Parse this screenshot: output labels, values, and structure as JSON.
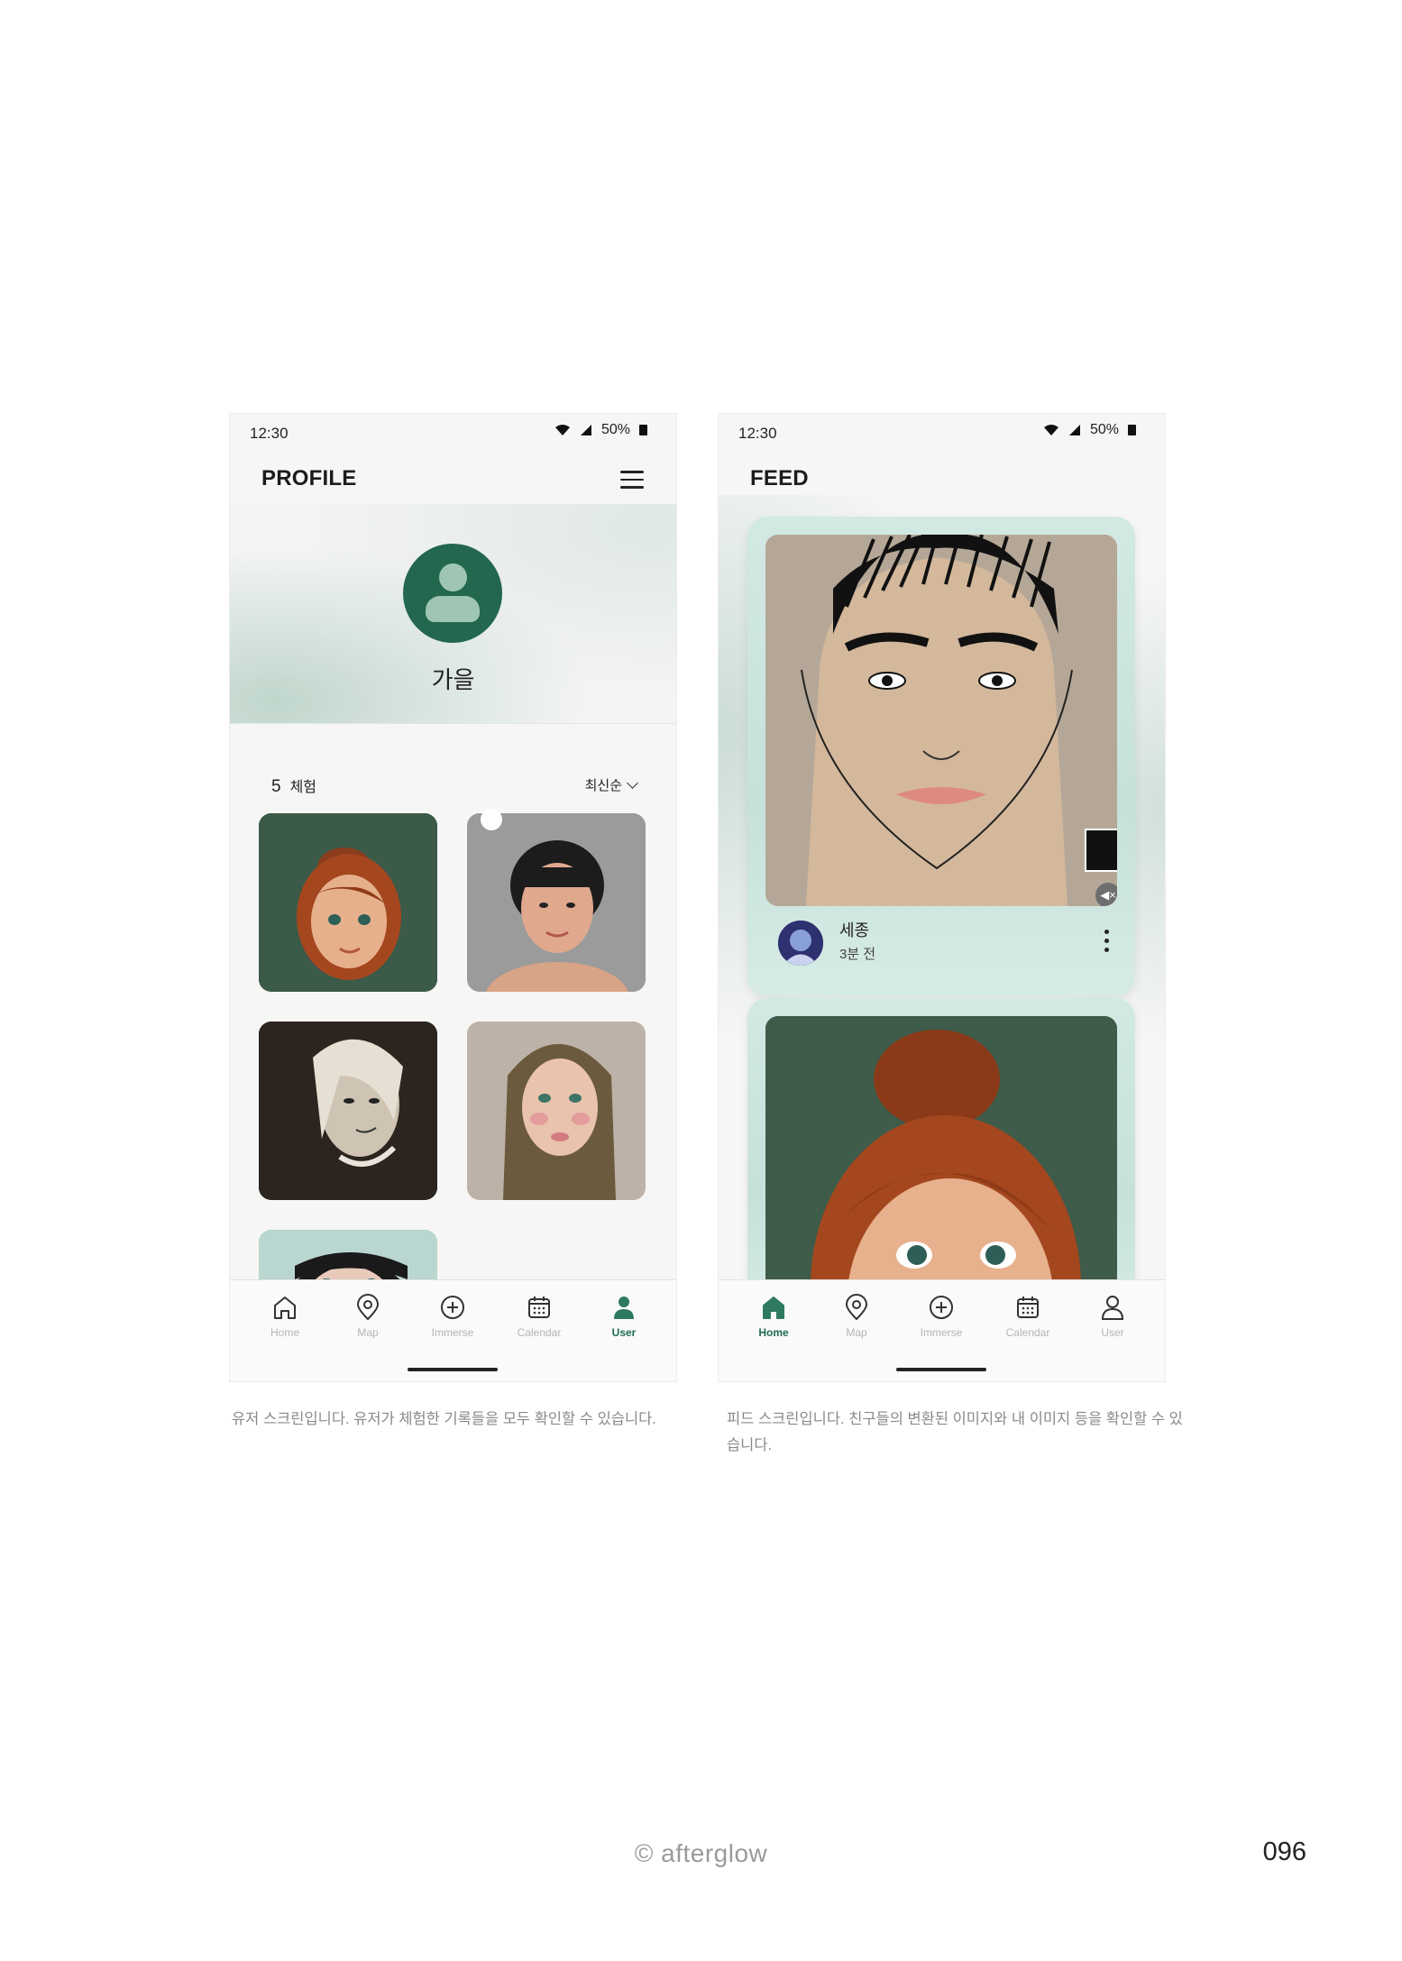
{
  "profile_screen": {
    "status_time": "12:30",
    "status_battery": "50%",
    "title": "PROFILE",
    "user_name": "가을",
    "experience_count": "5",
    "experience_label": "체험",
    "sort_label": "최신순",
    "nav": [
      "Home",
      "Map",
      "Immerse",
      "Calendar",
      "User"
    ],
    "active_nav": "User"
  },
  "feed_screen": {
    "status_time": "12:30",
    "status_battery": "50%",
    "title": "FEED",
    "post": {
      "user_name": "세종",
      "time_ago": "3분 전"
    },
    "nav": [
      "Home",
      "Map",
      "Immerse",
      "Calendar",
      "User"
    ],
    "active_nav": "Home"
  },
  "captions": {
    "left": "유저 스크린입니다. 유저가 체험한 기록들을 모두 확인할 수 있습니다.",
    "right": "피드 스크린입니다. 친구들의 변환된 이미지와 내 이미지 등을 확인할 수 있습니다."
  },
  "footer": {
    "copyright": "© afterglow",
    "page_number": "096"
  },
  "colors": {
    "accent": "#23674f",
    "card_tint": "#cfe6df",
    "inactive_nav": "#b5b5b5"
  }
}
